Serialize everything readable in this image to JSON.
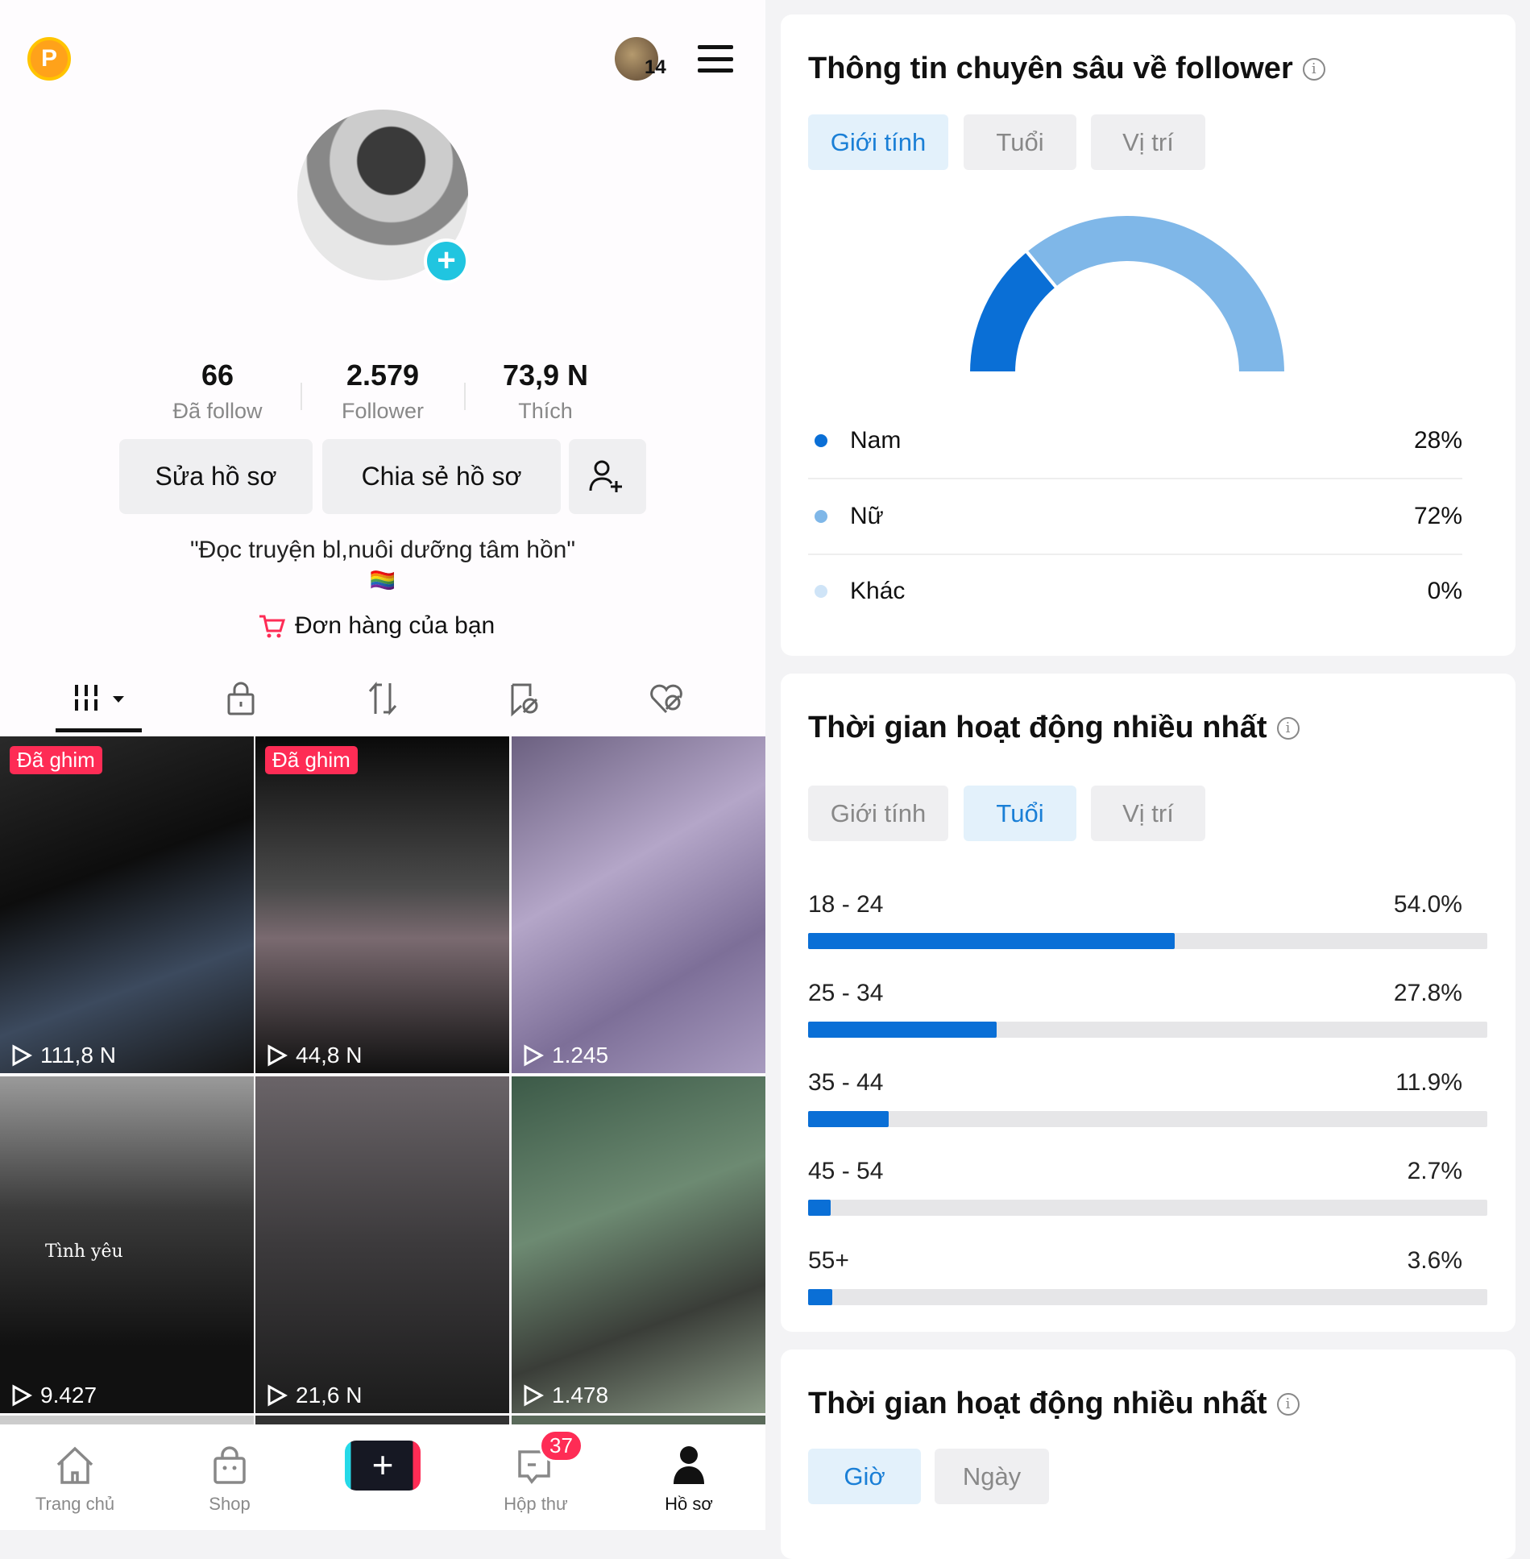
{
  "header": {
    "coin_label": "P",
    "notification_count": "14"
  },
  "profile": {
    "stats": [
      {
        "value": "66",
        "label": "Đã follow"
      },
      {
        "value": "2.579",
        "label": "Follower"
      },
      {
        "value": "73,9 N",
        "label": "Thích"
      }
    ],
    "edit_label": "Sửa hồ sơ",
    "share_label": "Chia sẻ hồ sơ",
    "bio": "\"Đọc truyện bl,nuôi dưỡng tâm hồn\"",
    "bio_emoji": "🏳️‍🌈",
    "orders_label": "Đơn hàng của bạn"
  },
  "content_tabs": [
    "videos-icon",
    "lock-icon",
    "repost-icon",
    "saved-icon",
    "liked-icon"
  ],
  "videos": [
    {
      "pinned": true,
      "pin_label": "Đã ghim",
      "views": "111,8 N"
    },
    {
      "pinned": true,
      "pin_label": "Đã ghim",
      "views": "44,8 N"
    },
    {
      "pinned": false,
      "views": "1.245"
    },
    {
      "pinned": false,
      "views": "9.427",
      "caption": "Tình yêu"
    },
    {
      "pinned": false,
      "views": "21,6 N"
    },
    {
      "pinned": false,
      "views": "1.478"
    }
  ],
  "bottom_nav": [
    {
      "label": "Trang chủ"
    },
    {
      "label": "Shop"
    },
    {
      "label": ""
    },
    {
      "label": "Hộp thư",
      "badge": "37"
    },
    {
      "label": "Hồ sơ",
      "active": true
    }
  ],
  "insights": {
    "title": "Thông tin chuyên sâu về follower",
    "tabs": [
      "Giới tính",
      "Tuổi",
      "Vị trí"
    ],
    "active_tab": 0,
    "chart_data": {
      "type": "pie",
      "style": "half-donut",
      "categories": [
        "Nam",
        "Nữ",
        "Khác"
      ],
      "values": [
        28,
        72,
        0
      ],
      "labels": [
        "28%",
        "72%",
        "0%"
      ],
      "colors": [
        "#0a6fd6",
        "#7fb7e8",
        "#cfe4f7"
      ]
    }
  },
  "activity": {
    "title": "Thời gian hoạt động nhiều nhất",
    "tabs": [
      "Giới tính",
      "Tuổi",
      "Vị trí"
    ],
    "active_tab": 1,
    "chart_data": {
      "type": "bar",
      "orientation": "horizontal",
      "categories": [
        "18 - 24",
        "25 - 34",
        "35 - 44",
        "45 - 54",
        "55+"
      ],
      "values": [
        54.0,
        27.8,
        11.9,
        2.7,
        3.6
      ],
      "labels": [
        "54.0%",
        "27.8%",
        "11.9%",
        "2.7%",
        "3.6%"
      ],
      "xlim": [
        0,
        100
      ],
      "color": "#0a6fd6"
    }
  },
  "activity2": {
    "title": "Thời gian hoạt động nhiều nhất",
    "tabs": [
      "Giờ",
      "Ngày"
    ],
    "active_tab": 0
  }
}
